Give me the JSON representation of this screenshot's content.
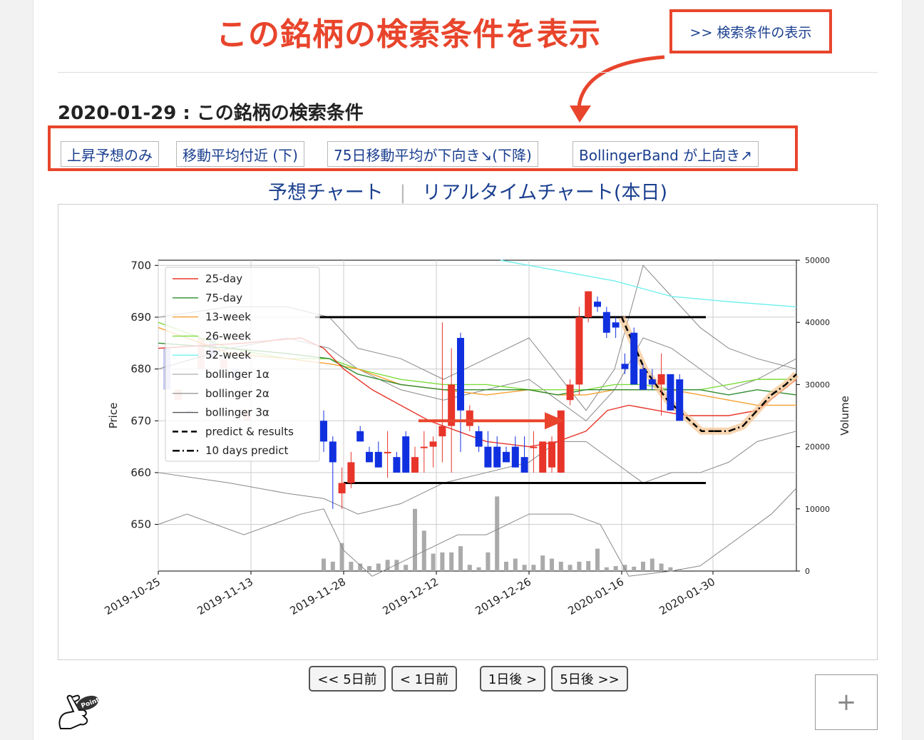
{
  "annotation": {
    "title": "この銘柄の検索条件を表示",
    "show_conditions_link": ">> 検索条件の表示",
    "highlight_color": "#e8452c"
  },
  "conditions": {
    "title": "2020-01-29 : この銘柄の検索条件",
    "tags": [
      "上昇予想のみ",
      "移動平均付近 (下)",
      "75日移動平均が下向き↘(下降)",
      "BollingerBand が上向き↗"
    ]
  },
  "chart_links": {
    "predict": "予想チャート",
    "separator": "|",
    "realtime": "リアルタイムチャート(本日)"
  },
  "chart_data": {
    "type": "candlestick",
    "y_left_label": "Price",
    "y_right_label": "Volume",
    "ylim": [
      641,
      701
    ],
    "y_ticks": [
      650,
      660,
      670,
      680,
      690,
      700
    ],
    "volume_ylim": [
      0,
      50000
    ],
    "volume_ticks": [
      0,
      10000,
      20000,
      30000,
      40000,
      50000
    ],
    "x_ticks": [
      "2019-10-25",
      "2019-11-13",
      "2019-11-28",
      "2019-12-12",
      "2019-12-26",
      "2020-01-16",
      "2020-01-30"
    ],
    "legend": [
      "25-day",
      "75-day",
      "13-week",
      "26-week",
      "52-week",
      "bollinger 1α",
      "bollinger 2α",
      "bollinger 3α",
      "predict & results",
      "10 days predict"
    ],
    "legend_position": "upper-left",
    "grid": true,
    "colors": {
      "up": "#e8352a",
      "down": "#1030e0",
      "ma25": "#e8352a",
      "ma75": "#2e8b2e",
      "w13": "#f5a030",
      "w26": "#7ddc3c",
      "w52": "#6ff0f0",
      "boll": "#888888",
      "volume": "#aaaaaa"
    },
    "resistance": 690,
    "support": 658,
    "candles": [
      {
        "o": 670,
        "h": 672,
        "l": 664,
        "c": 666,
        "v": 2000
      },
      {
        "o": 666,
        "h": 667,
        "l": 653,
        "c": 662,
        "v": 1500
      },
      {
        "o": 656,
        "h": 661,
        "l": 653,
        "c": 658,
        "v": 4500
      },
      {
        "o": 658,
        "h": 664,
        "l": 657,
        "c": 662,
        "v": 1500
      },
      {
        "o": 668,
        "h": 669,
        "l": 666,
        "c": 666,
        "v": 1200
      },
      {
        "o": 664,
        "h": 665,
        "l": 662,
        "c": 662,
        "v": 800
      },
      {
        "o": 664,
        "h": 666,
        "l": 661,
        "c": 661,
        "v": 1200
      },
      {
        "o": 664,
        "h": 668,
        "l": 659,
        "c": 664,
        "v": 1800
      },
      {
        "o": 663,
        "h": 664,
        "l": 660,
        "c": 660,
        "v": 1800
      },
      {
        "o": 667,
        "h": 668,
        "l": 660,
        "c": 660,
        "v": 1000
      },
      {
        "o": 660,
        "h": 665,
        "l": 660,
        "c": 663,
        "v": 10000
      },
      {
        "o": 665,
        "h": 668,
        "l": 660,
        "c": 665,
        "v": 6500
      },
      {
        "o": 665,
        "h": 667,
        "l": 661,
        "c": 666,
        "v": 2800
      },
      {
        "o": 667,
        "h": 689,
        "l": 662,
        "c": 669,
        "v": 3000
      },
      {
        "o": 669,
        "h": 684,
        "l": 660,
        "c": 677,
        "v": 3000
      },
      {
        "o": 686,
        "h": 687,
        "l": 664,
        "c": 672,
        "v": 4000
      },
      {
        "o": 669,
        "h": 673,
        "l": 668,
        "c": 672,
        "v": 1000
      },
      {
        "o": 668,
        "h": 669,
        "l": 664,
        "c": 665,
        "v": 600
      },
      {
        "o": 665,
        "h": 668,
        "l": 662,
        "c": 661,
        "v": 3000
      },
      {
        "o": 665,
        "h": 667,
        "l": 661,
        "c": 661,
        "v": 12000
      },
      {
        "o": 664,
        "h": 665,
        "l": 662,
        "c": 662,
        "v": 1500
      },
      {
        "o": 665,
        "h": 667,
        "l": 661,
        "c": 661,
        "v": 2000
      },
      {
        "o": 663,
        "h": 667,
        "l": 660,
        "c": 660,
        "v": 1000
      },
      {
        "o": 665,
        "h": 668,
        "l": 660,
        "c": 665,
        "v": 1000
      },
      {
        "o": 660,
        "h": 662,
        "l": 660,
        "c": 666,
        "v": 2500
      },
      {
        "o": 661,
        "h": 667,
        "l": 660,
        "c": 666,
        "v": 2000
      },
      {
        "o": 660,
        "h": 668,
        "l": 660,
        "c": 672,
        "v": 1500
      },
      {
        "o": 674,
        "h": 678,
        "l": 673,
        "c": 677,
        "v": 1000
      },
      {
        "o": 677,
        "h": 692,
        "l": 675,
        "c": 690,
        "v": 1500
      },
      {
        "o": 690,
        "h": 695,
        "l": 689,
        "c": 695,
        "v": 1600
      },
      {
        "o": 693,
        "h": 694,
        "l": 691,
        "c": 692,
        "v": 3600
      },
      {
        "o": 691,
        "h": 692,
        "l": 686,
        "c": 687,
        "v": 600
      },
      {
        "o": 689,
        "h": 690,
        "l": 686,
        "c": 688,
        "v": 800
      },
      {
        "o": 681,
        "h": 683,
        "l": 679,
        "c": 680,
        "v": 1000
      },
      {
        "o": 687,
        "h": 688,
        "l": 678,
        "c": 677,
        "v": 700
      },
      {
        "o": 680,
        "h": 681,
        "l": 676,
        "c": 676,
        "v": 1500
      },
      {
        "o": 678,
        "h": 680,
        "l": 676,
        "c": 677,
        "v": 2000
      },
      {
        "o": 677,
        "h": 683,
        "l": 671,
        "c": 679,
        "v": 1200
      },
      {
        "o": 679,
        "h": 679,
        "l": 672,
        "c": 672,
        "v": 600
      },
      {
        "o": 678,
        "h": 679,
        "l": 670,
        "c": 670,
        "v": 300
      }
    ]
  },
  "navigation": [
    "<< 5日前",
    "< 1日前",
    "1日後 >",
    "5日後 >>"
  ],
  "plus_button": "+",
  "point_icon_text": "Point"
}
